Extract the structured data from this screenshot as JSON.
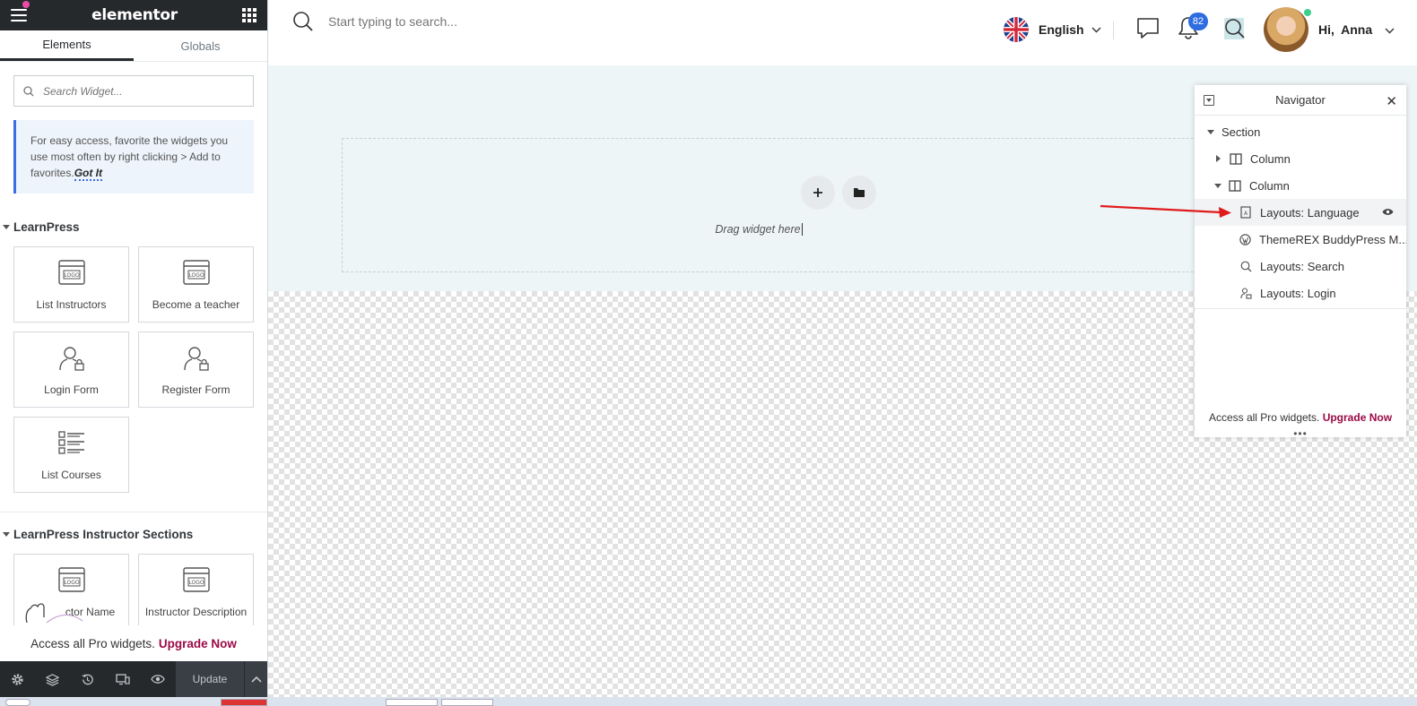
{
  "panel": {
    "brand": "elementor",
    "tabs": [
      "Elements",
      "Globals"
    ],
    "search_placeholder": "Search Widget...",
    "tip_text": "For easy access, favorite the widgets you use most often by right clicking > Add to favorites.",
    "tip_link": "Got It",
    "category1": "LearnPress",
    "widgets1": [
      "List Instructors",
      "Become a teacher",
      "Login Form",
      "Register Form",
      "List Courses"
    ],
    "category2": "LearnPress Instructor Sections",
    "widgets2": [
      "Instructor Name",
      "Instructor Description"
    ],
    "widget2_0_visible": "ctor Name",
    "pro_text": "Access all Pro widgets.",
    "pro_link": "Upgrade Now",
    "update_label": "Update"
  },
  "topbar": {
    "search_placeholder": "Start typing to search...",
    "language": "English",
    "notification_count": "82",
    "greeting": "Hi,  Anna"
  },
  "canvas": {
    "drag_label": "Drag widget here"
  },
  "navigator": {
    "title": "Navigator",
    "items": [
      {
        "label": "Section"
      },
      {
        "label": "Column"
      },
      {
        "label": "Column"
      },
      {
        "label": "Layouts: Language"
      },
      {
        "label": "ThemeREX BuddyPress M..."
      },
      {
        "label": "Layouts: Search"
      },
      {
        "label": "Layouts: Login"
      }
    ],
    "pro_text": "Access all Pro widgets.",
    "pro_link": "Upgrade Now"
  },
  "colors": {
    "header_dark": "#26292c",
    "accent_pink": "#9b0a46",
    "badge_blue": "#2e6de0",
    "annotation_red": "#e01b1b"
  }
}
